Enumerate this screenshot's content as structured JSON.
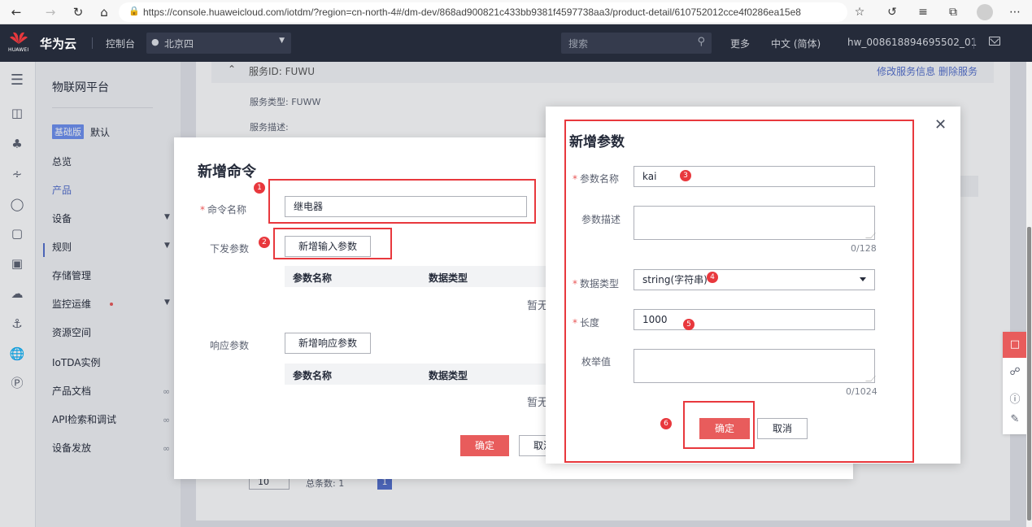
{
  "browser": {
    "url": "https://console.huaweicloud.com/iotdm/?region=cn-north-4#/dm-dev/868ad900821c433bb9381f4597738aa3/product-detail/610752012cce4f0286ea15e8"
  },
  "header": {
    "logo_text": "HUAWEI",
    "brand": "华为云",
    "console": "控制台",
    "region": "北京四",
    "search_placeholder": "搜索",
    "more": "更多",
    "language": "中文 (简体)",
    "account": "hw_008618894695502_01"
  },
  "sidebar": {
    "title": "物联网平台",
    "edition_badge": "基础版",
    "edition_default": "默认",
    "items": [
      {
        "label": "总览"
      },
      {
        "label": "产品"
      },
      {
        "label": "设备"
      },
      {
        "label": "规则"
      },
      {
        "label": "存储管理"
      },
      {
        "label": "监控运维"
      },
      {
        "label": "资源空间"
      },
      {
        "label": "IoTDA实例"
      },
      {
        "label": "产品文档"
      },
      {
        "label": "API检索和调试"
      },
      {
        "label": "设备发放"
      }
    ]
  },
  "background": {
    "service_id": "服务ID: FUWU",
    "service_ops": "修改服务信息    删除服务",
    "service_type": "服务类型: FUWW",
    "service_desc": "服务描述:",
    "page_size": "10",
    "total": "总条数: 1",
    "page": "1"
  },
  "command_dialog": {
    "title": "新增命令",
    "name_label": "命令名称",
    "name_value": "继电器",
    "downlink_label": "下发参数",
    "add_input_button": "新增输入参数",
    "col_param_name": "参数名称",
    "col_data_type": "数据类型",
    "empty": "暂无",
    "response_label": "响应参数",
    "add_response_button": "新增响应参数",
    "confirm": "确定",
    "cancel": "取消"
  },
  "param_dialog": {
    "title": "新增参数",
    "name_label": "参数名称",
    "name_value": "kai",
    "desc_label": "参数描述",
    "desc_counter": "0/128",
    "type_label": "数据类型",
    "type_value": "string(字符串)",
    "length_label": "长度",
    "length_value": "1000",
    "enum_label": "枚举值",
    "enum_counter": "0/1024",
    "confirm": "确定",
    "cancel": "取消"
  },
  "annotations": [
    "1",
    "2",
    "3",
    "4",
    "5",
    "6"
  ],
  "colors": {
    "primary_button": "#e85c5c",
    "annotation_red": "#e8383d",
    "header_bg": "#252b3a",
    "nav_active": "#526ecc"
  }
}
